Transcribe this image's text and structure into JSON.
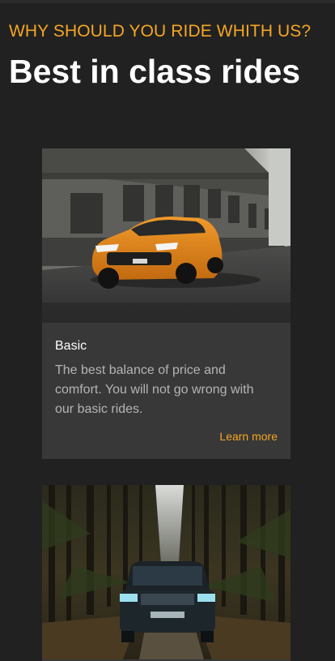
{
  "section": {
    "eyebrow": "WHY SHOULD YOU RIDE WHITH US?",
    "headline": "Best in class rides"
  },
  "cards": [
    {
      "title": "Basic",
      "description": "The best balance of price and comfort. You will not go wrong with our basic rides.",
      "link": "Learn more",
      "image": "orange-hatchback-photo"
    },
    {
      "image": "black-suv-forest-photo"
    }
  ],
  "colors": {
    "accent": "#f5a623",
    "background": "#212121",
    "card": "#383838",
    "body_text": "#b4b4b4"
  }
}
